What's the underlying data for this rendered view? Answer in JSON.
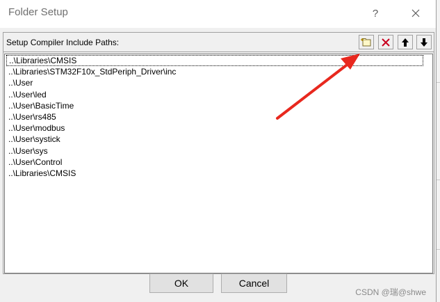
{
  "window": {
    "title": "Folder Setup",
    "help_glyph": "?"
  },
  "group": {
    "label": "Setup Compiler Include Paths:"
  },
  "paths": [
    "..\\Libraries\\CMSIS",
    "..\\Libraries\\STM32F10x_StdPeriph_Driver\\inc",
    "..\\User",
    "..\\User\\led",
    "..\\User\\BasicTime",
    "..\\User\\rs485",
    "..\\User\\modbus",
    "..\\User\\systick",
    "..\\User\\sys",
    "..\\User\\Control",
    "..\\Libraries\\CMSIS"
  ],
  "focused_index": 0,
  "buttons": {
    "ok": "OK",
    "cancel": "Cancel"
  },
  "toolbar_icons": [
    "new-folder-icon",
    "delete-x-icon",
    "arrow-up-icon",
    "arrow-down-icon"
  ],
  "annotation": {
    "arrow_color": "#e8281e"
  },
  "watermark": "CSDN @瑞@shwe"
}
